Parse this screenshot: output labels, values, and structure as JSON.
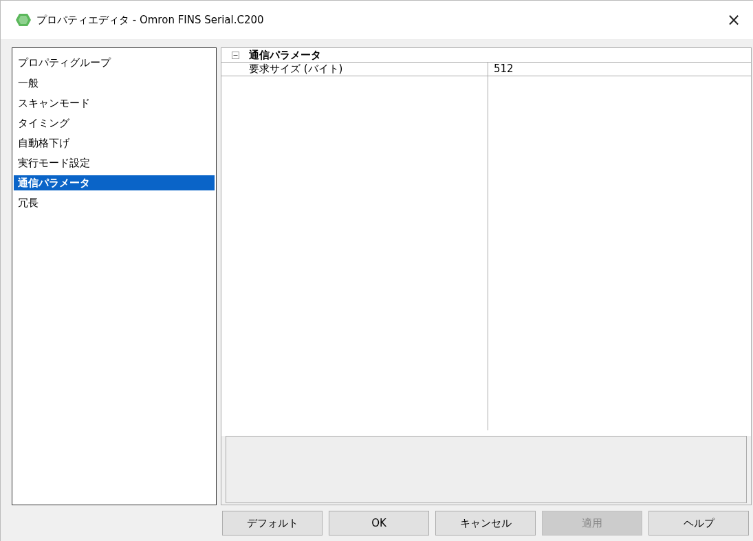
{
  "window": {
    "title": "プロパティエディタ - Omron FINS Serial.C200",
    "close": "×"
  },
  "sidebar": {
    "header": "プロパティグループ",
    "items": [
      {
        "label": "一般",
        "selected": false
      },
      {
        "label": "スキャンモード",
        "selected": false
      },
      {
        "label": "タイミング",
        "selected": false
      },
      {
        "label": "自動格下げ",
        "selected": false
      },
      {
        "label": "実行モード設定",
        "selected": false
      },
      {
        "label": "通信パラメータ",
        "selected": true
      },
      {
        "label": "冗長",
        "selected": false
      }
    ]
  },
  "property_grid": {
    "category": {
      "title": "通信パラメータ",
      "expanded": true
    },
    "rows": [
      {
        "name": "要求サイズ (バイト)",
        "value": "512"
      }
    ]
  },
  "buttons": [
    {
      "label": "デフォルト",
      "disabled": false
    },
    {
      "label": "OK",
      "disabled": false
    },
    {
      "label": "キャンセル",
      "disabled": false
    },
    {
      "label": "適用",
      "disabled": true
    },
    {
      "label": "ヘルプ",
      "disabled": false
    }
  ]
}
